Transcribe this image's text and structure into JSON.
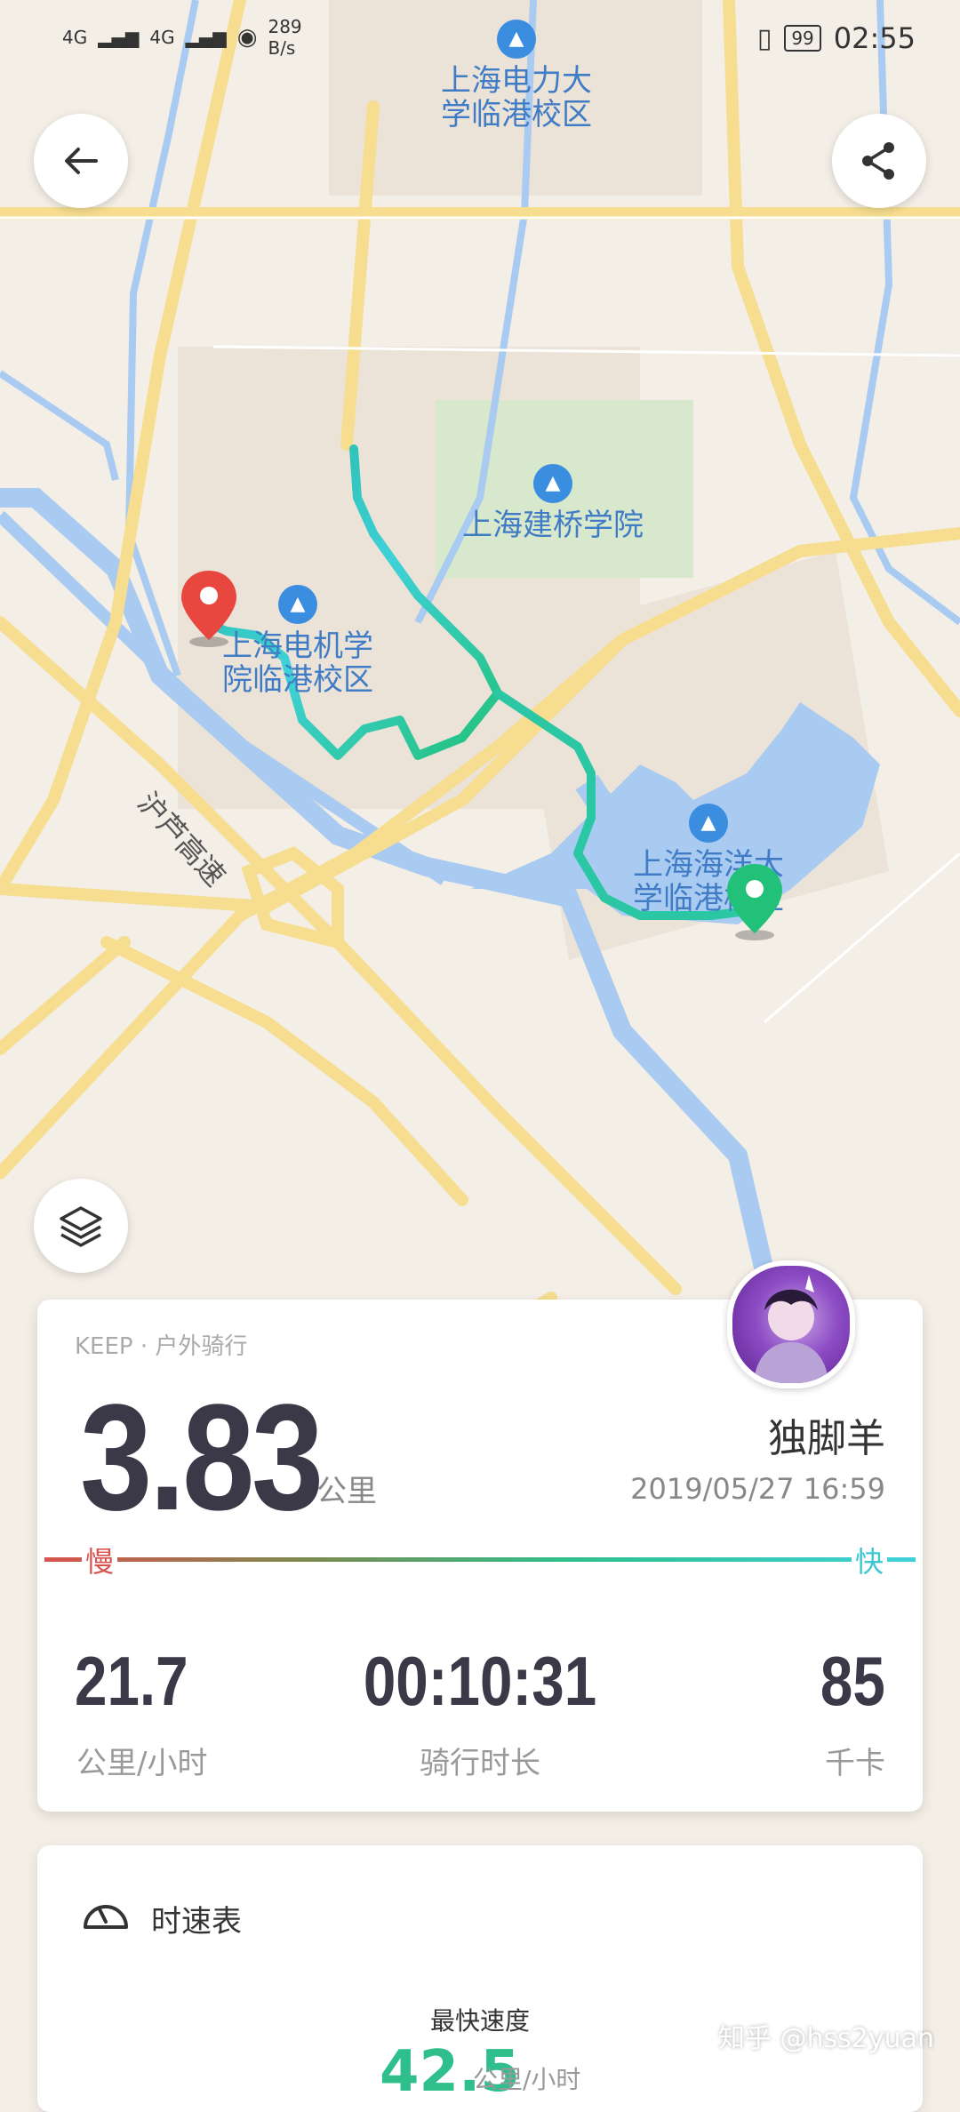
{
  "status_bar": {
    "net1": "4G",
    "net2": "4G",
    "speed_value": "289",
    "speed_unit": "B/s",
    "battery": "99",
    "time": "02:55"
  },
  "map": {
    "pois": [
      {
        "line1": "上海电力大",
        "line2": "学临港校区"
      },
      {
        "line1": "上海建桥学院",
        "line2": ""
      },
      {
        "line1": "上海电机学",
        "line2": "院临港校区"
      },
      {
        "line1": "上海海洋大",
        "line2": "学临港校区"
      }
    ],
    "road_label": "沪芦高速"
  },
  "icons": {
    "back": "back-arrow-icon",
    "share": "share-icon",
    "layers": "layers-icon",
    "start": "start-marker-icon",
    "end": "end-marker-icon",
    "gauge": "speedometer-icon"
  },
  "summary": {
    "source": "KEEP · 户外骑行",
    "distance": "3.83",
    "distance_unit": "公里",
    "user_name": "独脚羊",
    "date": "2019/05/27 16:59",
    "slow_label": "慢",
    "fast_label": "快",
    "stats": [
      {
        "value": "21.7",
        "label": "公里/小时"
      },
      {
        "value": "00:10:31",
        "label": "骑行时长"
      },
      {
        "value": "85",
        "label": "千卡"
      }
    ]
  },
  "speedometer": {
    "title": "时速表",
    "fastest_label": "最快速度",
    "fastest_value": "42.5",
    "fastest_unit": "公里/小时"
  },
  "watermark": "知乎 @hss2yuan",
  "colors": {
    "route_start": "#1fb59a",
    "route_end": "#3fd1d8",
    "start_marker": "#e8473f",
    "end_marker": "#22c17a",
    "water": "#a9cbf1",
    "road": "#f6dd8f"
  }
}
